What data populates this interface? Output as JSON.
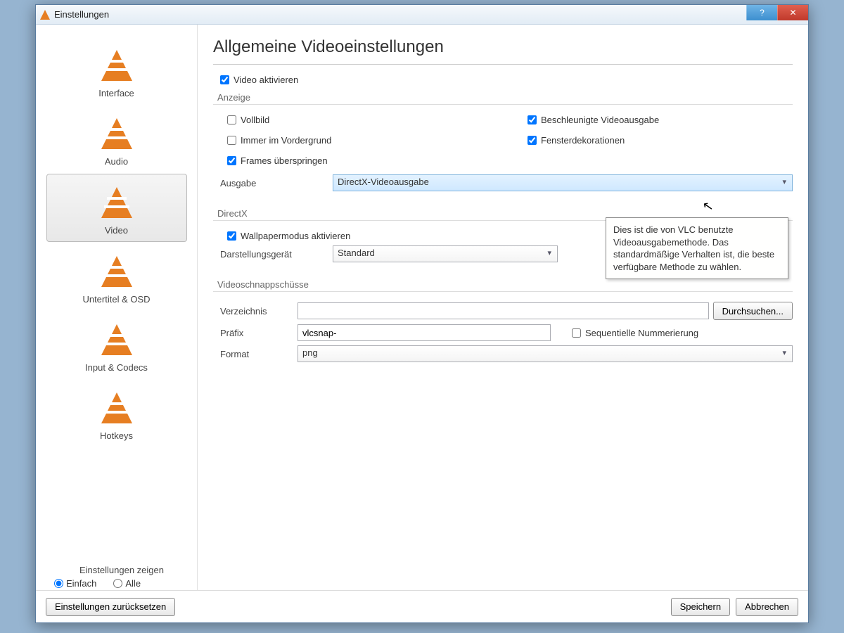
{
  "window": {
    "title": "Einstellungen",
    "help": "?",
    "close": "✕"
  },
  "sidebar": {
    "items": [
      {
        "label": "Interface"
      },
      {
        "label": "Audio"
      },
      {
        "label": "Video"
      },
      {
        "label": "Untertitel & OSD"
      },
      {
        "label": "Input & Codecs"
      },
      {
        "label": "Hotkeys"
      }
    ],
    "show_settings_label": "Einstellungen zeigen",
    "simple_label": "Einfach",
    "all_label": "Alle"
  },
  "page": {
    "title": "Allgemeine Videoeinstellungen",
    "enable_video": "Video aktivieren",
    "group_display": {
      "title": "Anzeige",
      "fullscreen": "Vollbild",
      "always_on_top": "Immer im Vordergrund",
      "skip_frames": "Frames überspringen",
      "accel_output": "Beschleunigte Videoausgabe",
      "window_decorations": "Fensterdekorationen",
      "output_label": "Ausgabe",
      "output_value": "DirectX-Videoausgabe"
    },
    "group_directx": {
      "title": "DirectX",
      "wallpaper_mode": "Wallpapermodus aktivieren",
      "display_device_label": "Darstellungsgerät",
      "display_device_value": "Standard"
    },
    "group_snapshots": {
      "title": "Videoschnappschüsse",
      "directory_label": "Verzeichnis",
      "directory_value": "",
      "browse_label": "Durchsuchen...",
      "prefix_label": "Präfix",
      "prefix_value": "vlcsnap-",
      "sequential_label": "Sequentielle Nummerierung",
      "format_label": "Format",
      "format_value": "png"
    },
    "tooltip": "Dies ist die von VLC benutzte Videoausgabemethode. Das standardmäßige Verhalten ist, die beste verfügbare Methode zu wählen."
  },
  "footer": {
    "reset": "Einstellungen zurücksetzen",
    "save": "Speichern",
    "cancel": "Abbrechen"
  }
}
